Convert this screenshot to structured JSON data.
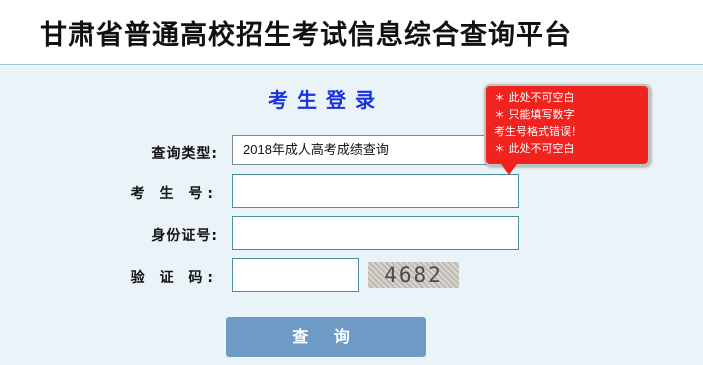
{
  "header": {
    "title": "甘肃省普通高校招生考试信息综合查询平台"
  },
  "login": {
    "title": "考生登录",
    "labels": {
      "query_type": "查询类型:",
      "exam_no": "考 生 号:",
      "id_card": "身份证号:",
      "captcha": "验 证 码:"
    },
    "query_type_value": "2018年成人高考成绩查询",
    "exam_no_value": "",
    "id_card_value": "",
    "captcha_input_value": "",
    "captcha_image_text": "4682",
    "submit_label": "查 询"
  },
  "validation_tooltip": {
    "lines": [
      "＊ 此处不可空白",
      "＊ 只能填写数字",
      "考生号格式错误！",
      "＊ 此处不可空白"
    ]
  },
  "colors": {
    "title_blue": "#1a31e0",
    "button_bg": "#6d9bc6",
    "tooltip_red": "#f0231f",
    "page_bg": "#eaf3f8"
  }
}
